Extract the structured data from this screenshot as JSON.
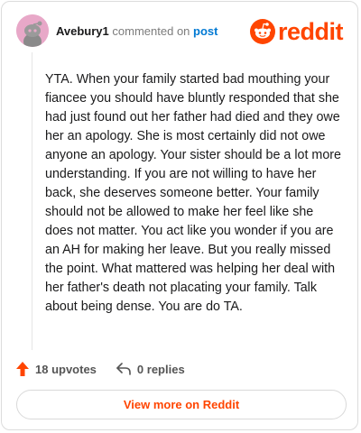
{
  "header": {
    "username": "Avebury1",
    "action_text": "commented on",
    "post_link": "post",
    "logo_text": "reddit"
  },
  "comment": {
    "body": "YTA. When your family started bad mouthing your fiancee you should have bluntly responded that she had just found out her father had died and they owe her an apology. She is most certainly did not owe anyone an apology. Your sister should be a lot more understanding. If you are not willing to have her back, she deserves someone better. Your family should not be allowed to make her feel like she does not matter. You act like you wonder if you are an AH for making her leave. But you really missed the point. What mattered was helping her deal with her father's death not placating your family. Talk about being dense. You are do TA."
  },
  "actions": {
    "upvotes": "18 upvotes",
    "replies": "0 replies"
  },
  "footer": {
    "view_more": "View more on Reddit"
  },
  "colors": {
    "brand": "#ff4500",
    "link": "#0079d3",
    "avatar_bg": "#e8a8c8"
  },
  "icons": [
    "avatar-snoo-icon",
    "reddit-logo-icon",
    "upvote-arrow-icon",
    "reply-icon"
  ]
}
